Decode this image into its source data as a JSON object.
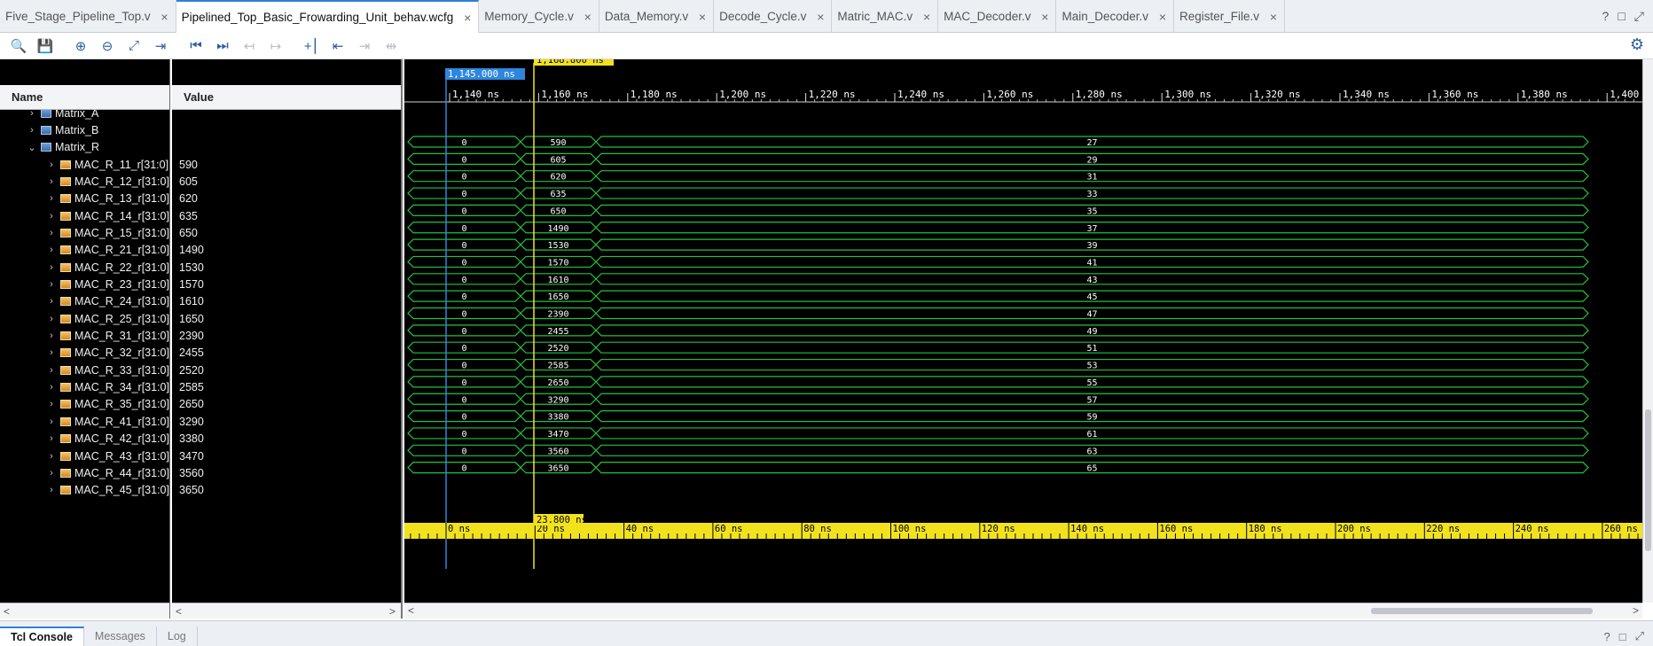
{
  "tabs": [
    {
      "label": "Five_Stage_Pipeline_Top.v",
      "active": false
    },
    {
      "label": "Pipelined_Top_Basic_Frowarding_Unit_behav.wcfg",
      "active": true
    },
    {
      "label": "Memory_Cycle.v",
      "active": false
    },
    {
      "label": "Data_Memory.v",
      "active": false
    },
    {
      "label": "Decode_Cycle.v",
      "active": false
    },
    {
      "label": "Matric_MAC.v",
      "active": false
    },
    {
      "label": "MAC_Decoder.v",
      "active": false
    },
    {
      "label": "Main_Decoder.v",
      "active": false
    },
    {
      "label": "Register_File.v",
      "active": false
    }
  ],
  "tab_close_glyph": "×",
  "window_actions": {
    "help": "?",
    "restore": "□",
    "maximize": "⤢"
  },
  "toolbar": {
    "buttons": [
      {
        "name": "search-icon",
        "glyph": "🔍",
        "enabled": true
      },
      {
        "name": "save-icon",
        "glyph": "💾",
        "enabled": true
      },
      {
        "name": "zoom-in-icon",
        "glyph": "⊕",
        "enabled": true
      },
      {
        "name": "zoom-out-icon",
        "glyph": "⊖",
        "enabled": true
      },
      {
        "name": "zoom-fit-icon",
        "glyph": "⤢",
        "enabled": true
      },
      {
        "name": "go-to-cursor-icon",
        "glyph": "⇥",
        "enabled": true
      },
      {
        "name": "go-to-start-icon",
        "glyph": "⏮",
        "enabled": true
      },
      {
        "name": "go-to-end-icon",
        "glyph": "⏭",
        "enabled": true
      },
      {
        "name": "previous-transition-icon",
        "glyph": "↤",
        "enabled": false
      },
      {
        "name": "next-transition-icon",
        "glyph": "↦",
        "enabled": false
      },
      {
        "name": "add-marker-icon",
        "glyph": "+⎮",
        "enabled": true
      },
      {
        "name": "previous-marker-icon",
        "glyph": "⇤",
        "enabled": true
      },
      {
        "name": "next-marker-icon",
        "glyph": "⇥",
        "enabled": false
      },
      {
        "name": "swap-cursors-icon",
        "glyph": "⇹",
        "enabled": false
      }
    ],
    "settings_glyph": "⚙"
  },
  "columns": {
    "name": "Name",
    "value": "Value"
  },
  "tree_rows": [
    {
      "label": "Matrix_A",
      "value": "",
      "kind": "group",
      "indent": 1,
      "expanded": false,
      "partial": true
    },
    {
      "label": "Matrix_B",
      "value": "",
      "kind": "group",
      "indent": 1,
      "expanded": false
    },
    {
      "label": "Matrix_R",
      "value": "",
      "kind": "group",
      "indent": 1,
      "expanded": true
    }
  ],
  "signals": [
    {
      "name": "MAC_R_11_r[31:0]",
      "value": "590",
      "v1": "0",
      "v2": "590",
      "v3": "27"
    },
    {
      "name": "MAC_R_12_r[31:0]",
      "value": "605",
      "v1": "0",
      "v2": "605",
      "v3": "29"
    },
    {
      "name": "MAC_R_13_r[31:0]",
      "value": "620",
      "v1": "0",
      "v2": "620",
      "v3": "31"
    },
    {
      "name": "MAC_R_14_r[31:0]",
      "value": "635",
      "v1": "0",
      "v2": "635",
      "v3": "33"
    },
    {
      "name": "MAC_R_15_r[31:0]",
      "value": "650",
      "v1": "0",
      "v2": "650",
      "v3": "35"
    },
    {
      "name": "MAC_R_21_r[31:0]",
      "value": "1490",
      "v1": "0",
      "v2": "1490",
      "v3": "37"
    },
    {
      "name": "MAC_R_22_r[31:0]",
      "value": "1530",
      "v1": "0",
      "v2": "1530",
      "v3": "39"
    },
    {
      "name": "MAC_R_23_r[31:0]",
      "value": "1570",
      "v1": "0",
      "v2": "1570",
      "v3": "41"
    },
    {
      "name": "MAC_R_24_r[31:0]",
      "value": "1610",
      "v1": "0",
      "v2": "1610",
      "v3": "43"
    },
    {
      "name": "MAC_R_25_r[31:0]",
      "value": "1650",
      "v1": "0",
      "v2": "1650",
      "v3": "45"
    },
    {
      "name": "MAC_R_31_r[31:0]",
      "value": "2390",
      "v1": "0",
      "v2": "2390",
      "v3": "47"
    },
    {
      "name": "MAC_R_32_r[31:0]",
      "value": "2455",
      "v1": "0",
      "v2": "2455",
      "v3": "49"
    },
    {
      "name": "MAC_R_33_r[31:0]",
      "value": "2520",
      "v1": "0",
      "v2": "2520",
      "v3": "51"
    },
    {
      "name": "MAC_R_34_r[31:0]",
      "value": "2585",
      "v1": "0",
      "v2": "2585",
      "v3": "53"
    },
    {
      "name": "MAC_R_35_r[31:0]",
      "value": "2650",
      "v1": "0",
      "v2": "2650",
      "v3": "55"
    },
    {
      "name": "MAC_R_41_r[31:0]",
      "value": "3290",
      "v1": "0",
      "v2": "3290",
      "v3": "57"
    },
    {
      "name": "MAC_R_42_r[31:0]",
      "value": "3380",
      "v1": "0",
      "v2": "3380",
      "v3": "59"
    },
    {
      "name": "MAC_R_43_r[31:0]",
      "value": "3470",
      "v1": "0",
      "v2": "3470",
      "v3": "61"
    },
    {
      "name": "MAC_R_44_r[31:0]",
      "value": "3560",
      "v1": "0",
      "v2": "3560",
      "v3": "63"
    },
    {
      "name": "MAC_R_45_r[31:0]",
      "value": "3650",
      "v1": "0",
      "v2": "3650",
      "v3": "65"
    }
  ],
  "waveform": {
    "top_ruler_ticks": [
      "1,140 ns",
      "1,160 ns",
      "1,180 ns",
      "1,200 ns",
      "1,220 ns",
      "1,240 ns",
      "1,260 ns",
      "1,280 ns",
      "1,300 ns",
      "1,320 ns",
      "1,340 ns",
      "1,360 ns",
      "1,380 ns",
      "1,400 ns"
    ],
    "bottom_ruler_ticks": [
      "0 ns",
      "20 ns",
      "40 ns",
      "60 ns",
      "80 ns",
      "100 ns",
      "120 ns",
      "140 ns",
      "160 ns",
      "180 ns",
      "200 ns",
      "220 ns",
      "240 ns",
      "260 ns"
    ],
    "cursor_label": "1,168.800 ns",
    "marker_label": "1,145.000 ns",
    "delta_label": "23.800 ns",
    "colors": {
      "background": "#000000",
      "bus": "#21c23b",
      "cursor": "#f2e21e",
      "marker": "#2e86de",
      "ruler_text": "#ffffff",
      "delta_bar": "#f2e21e"
    }
  },
  "bottom_tabs": [
    {
      "label": "Tcl Console",
      "active": true
    },
    {
      "label": "Messages",
      "active": false
    },
    {
      "label": "Log",
      "active": false
    }
  ],
  "bottom_actions": {
    "help": "?",
    "restore": "□",
    "maximize": "⤢"
  },
  "scroll_arrows": {
    "left": "<",
    "right": ">"
  }
}
